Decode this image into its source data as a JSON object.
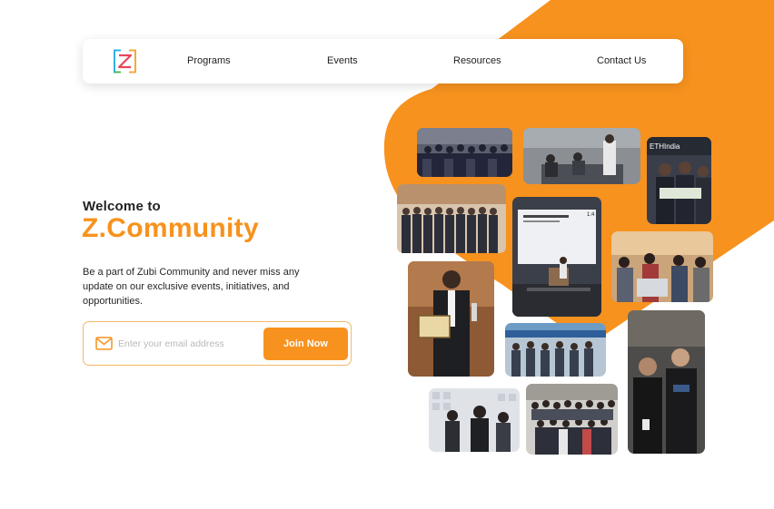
{
  "theme": {
    "accent": "#f7921e",
    "text": "#1a1a1a",
    "muted": "#b9b9b9"
  },
  "header": {
    "logo_icon": "z-logo-icon",
    "nav": [
      {
        "label": "Programs"
      },
      {
        "label": "Events"
      },
      {
        "label": "Resources"
      },
      {
        "label": "Contact Us"
      }
    ]
  },
  "hero": {
    "welcome": "Welcome to",
    "brand": "Z.Community",
    "description": "Be a part of Zubi Community and never miss any update on our exclusive events, initiatives, and opportunities.",
    "email_icon": "mail-icon",
    "email_placeholder": "Enter your email address",
    "join_label": "Join Now"
  },
  "gallery": {
    "photos": [
      {
        "name": "group-photo"
      },
      {
        "name": "workshop-photo"
      },
      {
        "name": "hackathon-photo",
        "sign": "ETHIndia"
      },
      {
        "name": "team-photo"
      },
      {
        "name": "presentation-photo",
        "slide_number": "1:4"
      },
      {
        "name": "coding-session-photo"
      },
      {
        "name": "award-photo"
      },
      {
        "name": "outdoor-event-photo"
      },
      {
        "name": "duo-photo"
      },
      {
        "name": "booth-photo"
      },
      {
        "name": "crowd-photo"
      }
    ]
  }
}
